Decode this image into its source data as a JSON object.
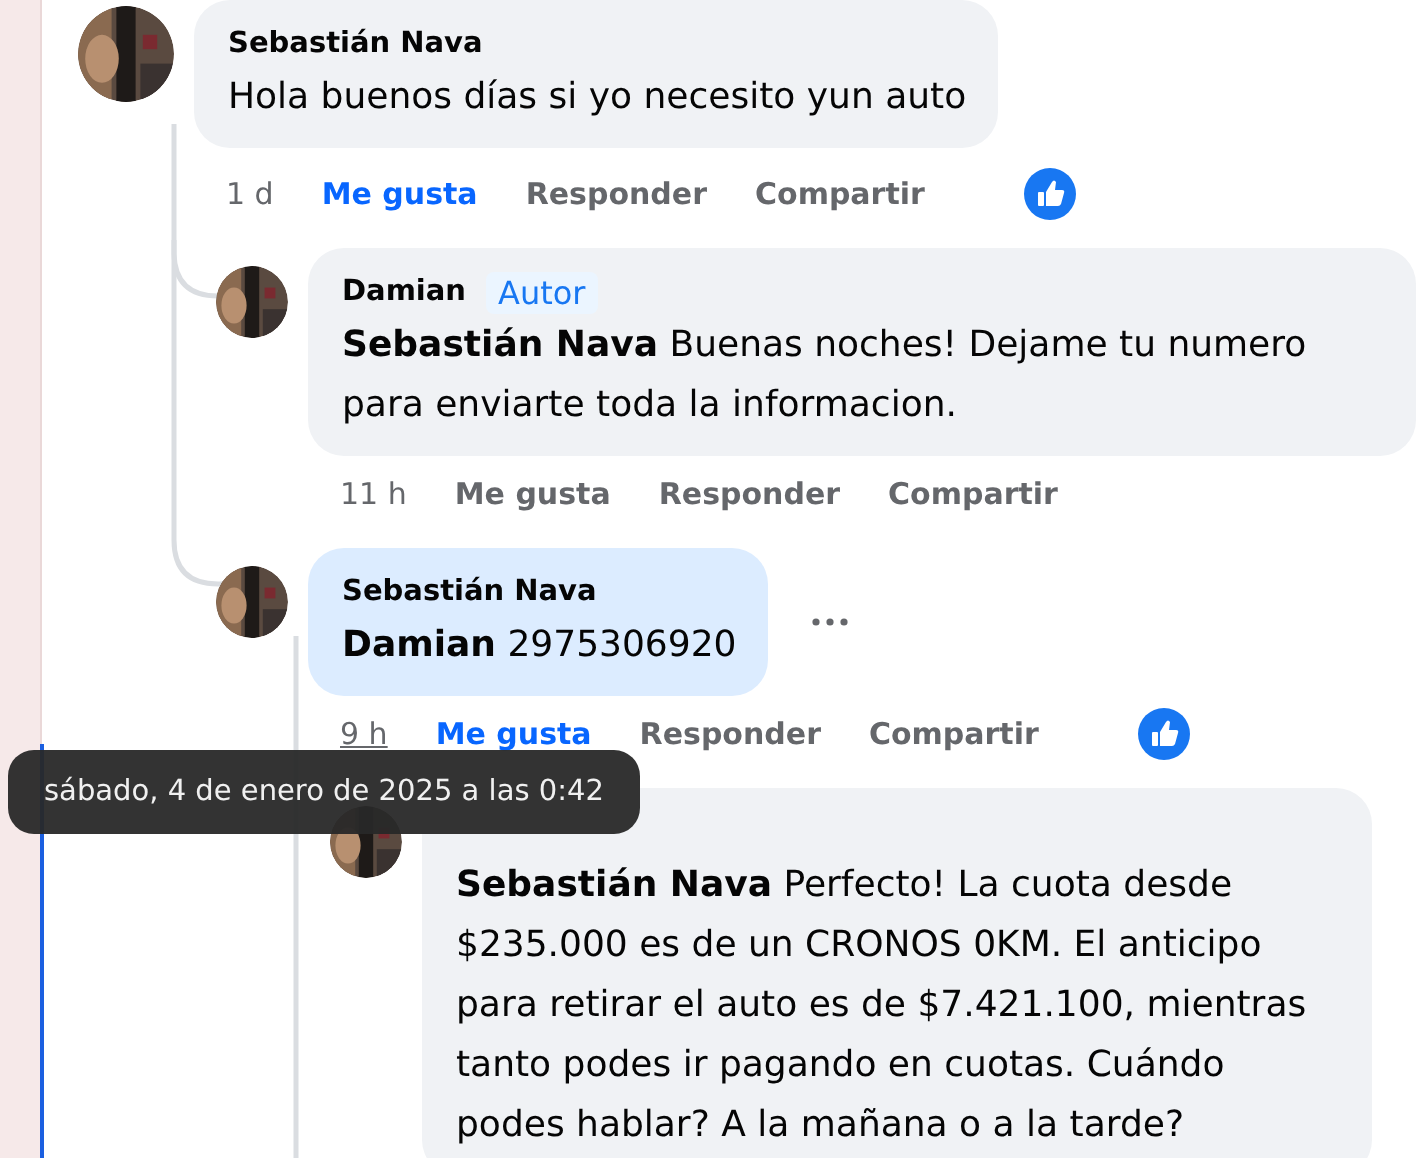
{
  "comments": [
    {
      "author": "Sebastián Nava",
      "text": "Hola buenos días si yo necesito yun auto",
      "time": "1 d",
      "time_hovered": false,
      "liked": true,
      "actions": [
        "Me gusta",
        "Responder",
        "Compartir"
      ],
      "reaction": true,
      "children": [
        {
          "author": "Damian",
          "badge": "Autor",
          "text": "**Sebastián Nava** Buenas noches! Dejame tu numero para enviarte toda la informacion.",
          "time": "11 h",
          "time_hovered": false,
          "liked": false,
          "actions": [
            "Me gusta",
            "Responder",
            "Compartir"
          ]
        },
        {
          "author": "Sebastián Nava",
          "text": "**Damian** 2975306920",
          "time": "9 h",
          "time_hovered": true,
          "liked": true,
          "actions": [
            "Me gusta",
            "Responder",
            "Compartir"
          ],
          "reaction": true,
          "highlighted": true,
          "show_menu": true,
          "children": [
            {
              "text": "**Sebastián Nava** Perfecto! La cuota desde $235.000 es de un CRONOS 0KM. El anticipo para retirar el auto es de $7.421.100, mientras tanto podes ir pagando en cuotas. Cuándo podes hablar? A la mañana o a la tarde?"
            }
          ]
        }
      ]
    }
  ],
  "tooltip": "sábado, 4 de enero de 2025 a las 0:42"
}
